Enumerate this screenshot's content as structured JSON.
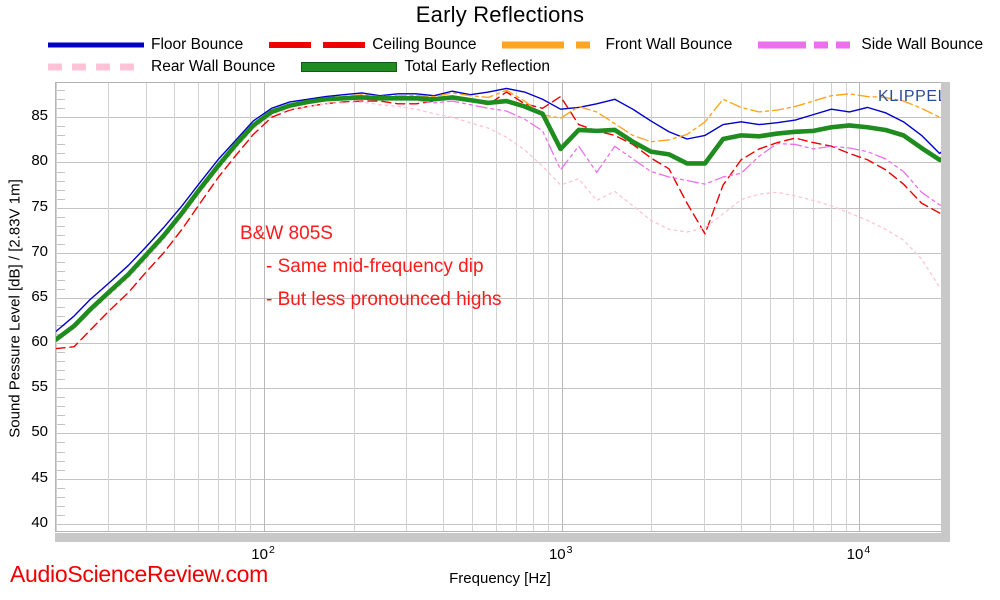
{
  "chart_data": {
    "type": "line",
    "title": "Early Reflections",
    "xlabel": "Frequency [Hz]",
    "ylabel": "Sound Pessure Level [dB] / [2.83V 1m]",
    "xscale": "log",
    "xlim": [
      20,
      20000
    ],
    "ylim": [
      39.2,
      88.8
    ],
    "yticks": [
      40,
      45,
      50,
      55,
      60,
      65,
      70,
      75,
      80,
      85
    ],
    "xticks": [
      100,
      1000,
      10000
    ],
    "xtick_labels": [
      "10 2",
      "10 3",
      "10 4"
    ],
    "grid": true,
    "minor_ticks": "1 dB on y-axis, log decade subdivisions on x-axis",
    "legend_position": "above plot, two rows",
    "watermarks": [
      {
        "text": "KLIPPEL",
        "color": "#2b4a9b",
        "position": "top-right inside plot"
      },
      {
        "text": "AudioScienceReview.com",
        "color": "#ee0000",
        "position": "bottom-left outside plot"
      }
    ],
    "annotations": [
      {
        "text": "B&W 805S",
        "color": "#ff1a1a"
      },
      {
        "text": "- Same mid-frequency dip",
        "color": "#ff1a1a"
      },
      {
        "text": "- But less pronounced highs",
        "color": "#ff1a1a"
      }
    ],
    "x": [
      20,
      23,
      26,
      30,
      35,
      40,
      46,
      53,
      61,
      70,
      80,
      92,
      106,
      122,
      140,
      161,
      185,
      213,
      245,
      282,
      324,
      373,
      429,
      493,
      567,
      652,
      750,
      862,
      991,
      1140,
      1311,
      1507,
      1733,
      1993,
      2292,
      2635,
      3030,
      3484,
      4006,
      4606,
      5296,
      6090,
      7002,
      8051,
      9257,
      10644,
      12238,
      14071,
      16178,
      18600,
      20000
    ],
    "series": [
      {
        "name": "Floor Bounce",
        "color": "#0000cc",
        "style": "solid",
        "width": 1.4,
        "values": [
          61.3,
          63.0,
          64.8,
          66.6,
          68.6,
          70.6,
          72.8,
          75.2,
          77.8,
          80.3,
          82.4,
          84.6,
          86.0,
          86.7,
          87.0,
          87.3,
          87.5,
          87.7,
          87.4,
          87.6,
          87.6,
          87.4,
          87.9,
          87.5,
          87.8,
          88.2,
          87.8,
          87.0,
          85.9,
          86.1,
          86.5,
          87.0,
          85.9,
          84.6,
          83.4,
          82.6,
          83.0,
          84.2,
          84.5,
          84.2,
          84.4,
          84.7,
          85.3,
          85.9,
          85.6,
          86.1,
          85.5,
          84.5,
          83.0,
          81.0,
          81.8
        ]
      },
      {
        "name": "Ceiling Bounce",
        "color": "#ee0000",
        "style": "dashed",
        "width": 1.4,
        "values": [
          59.4,
          59.6,
          61.4,
          63.5,
          65.6,
          67.8,
          70.0,
          72.6,
          75.5,
          78.3,
          80.7,
          83.1,
          85.0,
          85.8,
          86.2,
          86.5,
          86.7,
          86.8,
          86.8,
          86.5,
          86.5,
          86.8,
          87.2,
          86.8,
          86.4,
          87.8,
          86.5,
          86.0,
          87.3,
          84.2,
          83.5,
          83.0,
          82.0,
          80.5,
          79.3,
          75.5,
          72.1,
          77.5,
          80.3,
          81.5,
          82.2,
          82.7,
          82.2,
          81.8,
          81.0,
          80.3,
          79.2,
          77.6,
          75.5,
          74.4,
          74.3
        ]
      },
      {
        "name": "Front Wall Bounce",
        "color": "#ffa520",
        "style": "dashdot",
        "width": 1.4,
        "values": [
          60.5,
          62.0,
          63.8,
          65.7,
          67.8,
          69.8,
          72.0,
          74.5,
          77.2,
          79.8,
          82.0,
          84.2,
          85.7,
          86.4,
          86.8,
          87.1,
          87.3,
          87.5,
          87.3,
          87.4,
          87.4,
          87.3,
          87.7,
          87.4,
          87.2,
          88.0,
          86.8,
          85.3,
          84.9,
          86.2,
          85.6,
          84.3,
          83.0,
          82.3,
          82.5,
          83.1,
          84.5,
          87.0,
          86.1,
          85.6,
          85.8,
          86.2,
          86.8,
          87.4,
          87.6,
          87.3,
          87.2,
          86.8,
          86.0,
          85.0,
          85.3
        ]
      },
      {
        "name": "Side Wall Bounce",
        "color": "#ee6fee",
        "style": "dashdotdot",
        "width": 1.3,
        "values": [
          60.3,
          61.8,
          63.6,
          65.4,
          67.5,
          69.5,
          71.8,
          74.3,
          77.0,
          79.5,
          81.8,
          84.0,
          85.5,
          86.2,
          86.6,
          86.9,
          87.0,
          87.2,
          87.0,
          87.0,
          86.9,
          86.6,
          86.8,
          86.4,
          86.0,
          85.7,
          84.8,
          83.5,
          79.2,
          81.8,
          78.9,
          81.8,
          80.4,
          79.0,
          78.4,
          78.0,
          77.6,
          78.4,
          78.8,
          80.7,
          82.1,
          82.0,
          81.5,
          81.8,
          81.6,
          81.2,
          80.4,
          79.0,
          76.7,
          75.3,
          75.2
        ]
      },
      {
        "name": "Rear Wall Bounce",
        "color": "#ffc3d8",
        "style": "dotted",
        "width": 1.3,
        "values": [
          60.2,
          61.6,
          63.4,
          65.2,
          67.2,
          69.2,
          71.5,
          74.0,
          76.7,
          79.2,
          81.5,
          83.7,
          85.2,
          85.9,
          86.2,
          86.5,
          86.6,
          86.7,
          86.4,
          86.2,
          85.9,
          85.4,
          85.0,
          84.4,
          83.8,
          82.8,
          81.4,
          79.6,
          77.5,
          78.2,
          75.8,
          76.8,
          75.2,
          73.6,
          72.6,
          72.3,
          72.8,
          74.3,
          75.9,
          76.5,
          76.7,
          76.3,
          75.8,
          75.2,
          74.4,
          73.6,
          72.6,
          71.4,
          69.3,
          66.2,
          66.5
        ]
      },
      {
        "name": "Total Early Reflection",
        "color": "#1e8c1e",
        "style": "solid",
        "width": 4.6,
        "values": [
          60.4,
          61.9,
          63.7,
          65.6,
          67.6,
          69.7,
          71.9,
          74.4,
          77.1,
          79.6,
          81.9,
          84.1,
          85.6,
          86.3,
          86.7,
          87.0,
          87.1,
          87.2,
          87.1,
          87.1,
          87.1,
          87.0,
          87.2,
          86.9,
          86.6,
          86.8,
          86.2,
          85.4,
          81.5,
          83.6,
          83.5,
          83.6,
          82.3,
          81.2,
          80.9,
          79.9,
          79.9,
          82.6,
          83.0,
          82.9,
          83.2,
          83.4,
          83.5,
          83.9,
          84.1,
          83.9,
          83.6,
          83.0,
          81.6,
          80.3,
          80.5
        ]
      }
    ]
  },
  "header": {
    "title": "Early Reflections"
  },
  "legend": {
    "rows": [
      [
        {
          "label": "Floor Bounce",
          "color": "#0000cc",
          "style": "solid"
        },
        {
          "label": "Ceiling Bounce",
          "color": "#ee0000",
          "style": "dashed"
        },
        {
          "label": "Front Wall Bounce",
          "color": "#ffa520",
          "style": "dashdot"
        },
        {
          "label": "Side Wall Bounce",
          "color": "#ee6fee",
          "style": "dashdotdot"
        }
      ],
      [
        {
          "label": "Rear Wall Bounce",
          "color": "#ffc3d8",
          "style": "dotted"
        },
        {
          "label": "Total Early Reflection",
          "color": "#1e8c1e",
          "style": "thick"
        }
      ]
    ]
  },
  "axes": {
    "y_label": "Sound Pessure Level [dB] / [2.83V 1m]",
    "x_label": "Frequency [Hz]",
    "y_ticks": [
      "85",
      "80",
      "75",
      "70",
      "65",
      "60",
      "55",
      "50",
      "45",
      "40"
    ],
    "x_ticks": [
      {
        "mantissa": "10",
        "exponent": "2"
      },
      {
        "mantissa": "10",
        "exponent": "3"
      },
      {
        "mantissa": "10",
        "exponent": "4"
      }
    ]
  },
  "annotations": {
    "model": "B&W 805S",
    "note1": "- Same mid-frequency dip",
    "note2": "- But less pronounced highs"
  },
  "watermarks": {
    "klippel": "KLIPPEL",
    "asr": "AudioScienceReview.com"
  }
}
